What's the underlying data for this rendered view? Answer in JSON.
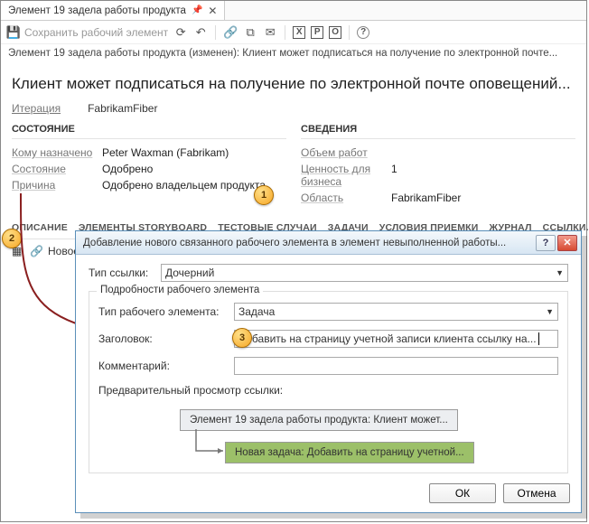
{
  "tab": {
    "title": "Элемент 19 задела работы продукта"
  },
  "toolbar": {
    "save": "Сохранить рабочий элемент"
  },
  "breadcrumb": "Элемент 19 задела работы продукта (изменен): Клиент может подписаться на получение по электронной почте...",
  "main_title": "Клиент может подписаться на получение по электронной почте оповещений...",
  "iteration": {
    "label": "Итерация",
    "value": "FabrikamFiber"
  },
  "status": {
    "heading": "СОСТОЯНИЕ",
    "rows": [
      {
        "label": "Кому назначено",
        "value": "Peter Waxman (Fabrikam)"
      },
      {
        "label": "Состояние",
        "value": "Одобрено"
      },
      {
        "label": "Причина",
        "value": "Одобрено владельцем продукта"
      }
    ]
  },
  "details": {
    "heading": "СВЕДЕНИЯ",
    "rows": [
      {
        "label": "Объем работ",
        "value": ""
      },
      {
        "label": "Ценность для бизнеса",
        "value": "1"
      },
      {
        "label": "Область",
        "value": "FabrikamFiber"
      }
    ]
  },
  "subtabs": [
    "ОПИСАНИЕ",
    "ЭЛЕМЕНТЫ STORYBOARD",
    "ТЕСТОВЫЕ СЛУЧАИ",
    "ЗАДАЧИ",
    "УСЛОВИЯ ПРИЕМКИ",
    "ЖУРНАЛ",
    "ССЫЛКИ..."
  ],
  "subtool": {
    "new_label": "Новое"
  },
  "dialog": {
    "title": "Добавление нового связанного рабочего элемента в элемент невыполненной работы...",
    "link_type_label": "Тип ссылки:",
    "link_type_value": "Дочерний",
    "group_title": "Подробности рабочего элемента",
    "wi_type_label": "Тип рабочего элемента:",
    "wi_type_value": "Задача",
    "title_label": "Заголовок:",
    "title_value": "Добавить на страницу учетной записи клиента ссылку на...",
    "comment_label": "Комментарий:",
    "comment_value": "",
    "preview_label": "Предварительный просмотр ссылки:",
    "preview_parent": "Элемент 19 задела работы продукта: Клиент может...",
    "preview_child": "Новая задача: Добавить на страницу учетной...",
    "ok": "ОК",
    "cancel": "Отмена"
  },
  "callouts": {
    "c1": "1",
    "c2": "2",
    "c3": "3"
  }
}
